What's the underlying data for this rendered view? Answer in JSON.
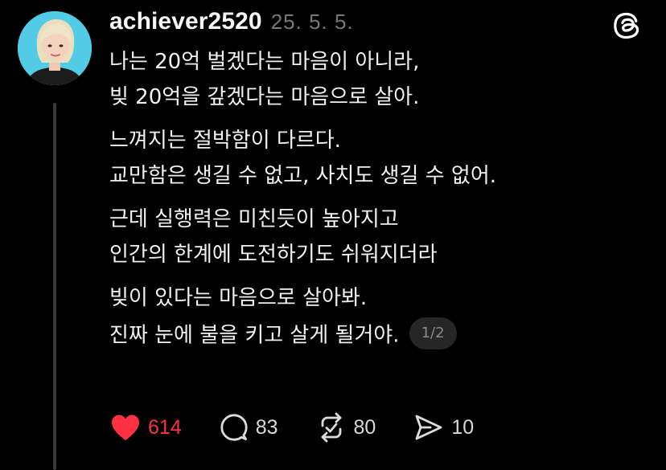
{
  "post": {
    "author": {
      "username": "achiever2520",
      "timestamp": "25. 5. 5."
    },
    "paragraphs": [
      [
        "나는 20억 벌겠다는 마음이 아니라,",
        "빚 20억을 갚겠다는 마음으로 살아."
      ],
      [
        "느껴지는 절박함이 다르다.",
        "교만함은 생길 수 없고, 사치도 생길 수 없어."
      ],
      [
        "근데 실행력은 미친듯이 높아지고",
        "인간의 한계에 도전하기도 쉬워지더라"
      ],
      [
        "빚이 있다는 마음으로 살아봐.",
        "진짜 눈에 불을 키고 살게 될거야."
      ]
    ],
    "page_indicator": "1/2"
  },
  "actions": {
    "like": {
      "count": "614",
      "icon": "heart-filled-icon",
      "active": true
    },
    "comment": {
      "count": "83",
      "icon": "comment-bubble-icon"
    },
    "repost": {
      "count": "80",
      "icon": "repost-icon"
    },
    "share": {
      "count": "10",
      "icon": "send-icon"
    }
  },
  "colors": {
    "background": "#000000",
    "text": "#f1f1f1",
    "muted": "#777777",
    "like_active": "#ff3040",
    "thread_line": "#383838",
    "avatar_bg": "#52cbe6"
  },
  "brand_icon": "threads-logo-icon"
}
